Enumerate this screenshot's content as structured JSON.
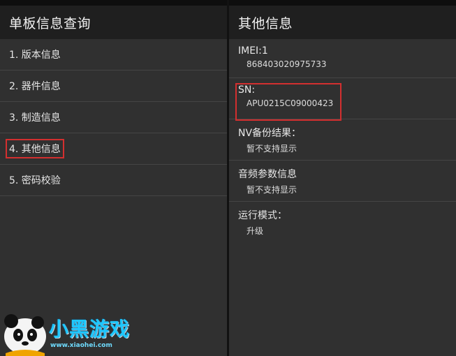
{
  "left": {
    "title": "单板信息查询",
    "items": [
      {
        "label": "1. 版本信息"
      },
      {
        "label": "2. 器件信息"
      },
      {
        "label": "3. 制造信息"
      },
      {
        "label": "4. 其他信息"
      },
      {
        "label": "5. 密码校验"
      }
    ]
  },
  "right": {
    "title": "其他信息",
    "rows": [
      {
        "title": "IMEI:1",
        "value": "868403020975733"
      },
      {
        "title": "SN:",
        "value": "APU0215C09000423"
      },
      {
        "title": "NV备份结果：",
        "value": "暂不支持显示"
      },
      {
        "title": "音频参数信息",
        "value": "暂不支持显示"
      },
      {
        "title": "运行模式：",
        "value": "升级"
      }
    ]
  },
  "watermark": {
    "logo_text": "小黑游戏",
    "url": "www.xiaohei.com"
  },
  "colors": {
    "highlight": "#d32f2f",
    "background": "#303030",
    "header": "#1f1f1f"
  }
}
